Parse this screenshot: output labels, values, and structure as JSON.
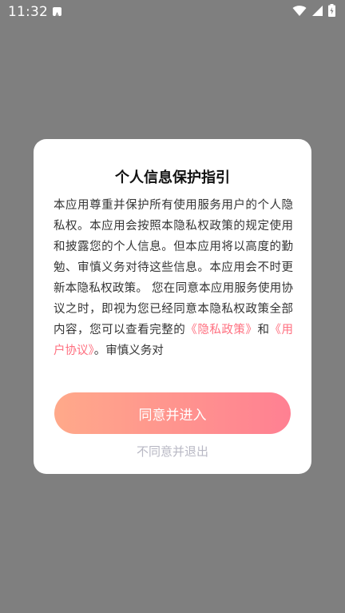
{
  "status_bar": {
    "time": "11:32",
    "notification_icon": "a-badge-icon",
    "icons": [
      "wifi-icon",
      "cell-signal-icon",
      "battery-icon"
    ]
  },
  "dialog": {
    "title": "个人信息保护指引",
    "body_text": "本应用尊重并保护所有使用服务用户的个人隐私权。本应用会按照本隐私权政策的规定使用和披露您的个人信息。但本应用将以高度的勤勉、审慎义务对待这些信息。本应用会不时更新本隐私权政策。 您在同意本应用服务使用协议之时，即视为您已经同意本隐私权政策全部内容，您可以查看完整的",
    "privacy_link": "《隐私政策》",
    "conjunction": "和",
    "user_agreement_link": "《用户协议》",
    "trailing_text": "。审慎义务对",
    "agree_label": "同意并进入",
    "disagree_label": "不同意并退出"
  },
  "colors": {
    "overlay": "#7f7f7f",
    "link": "#ff6f7f",
    "button_gradient_start": "#ffa98a",
    "button_gradient_end": "#ff8092",
    "disagree_text": "#b8b8c4"
  }
}
